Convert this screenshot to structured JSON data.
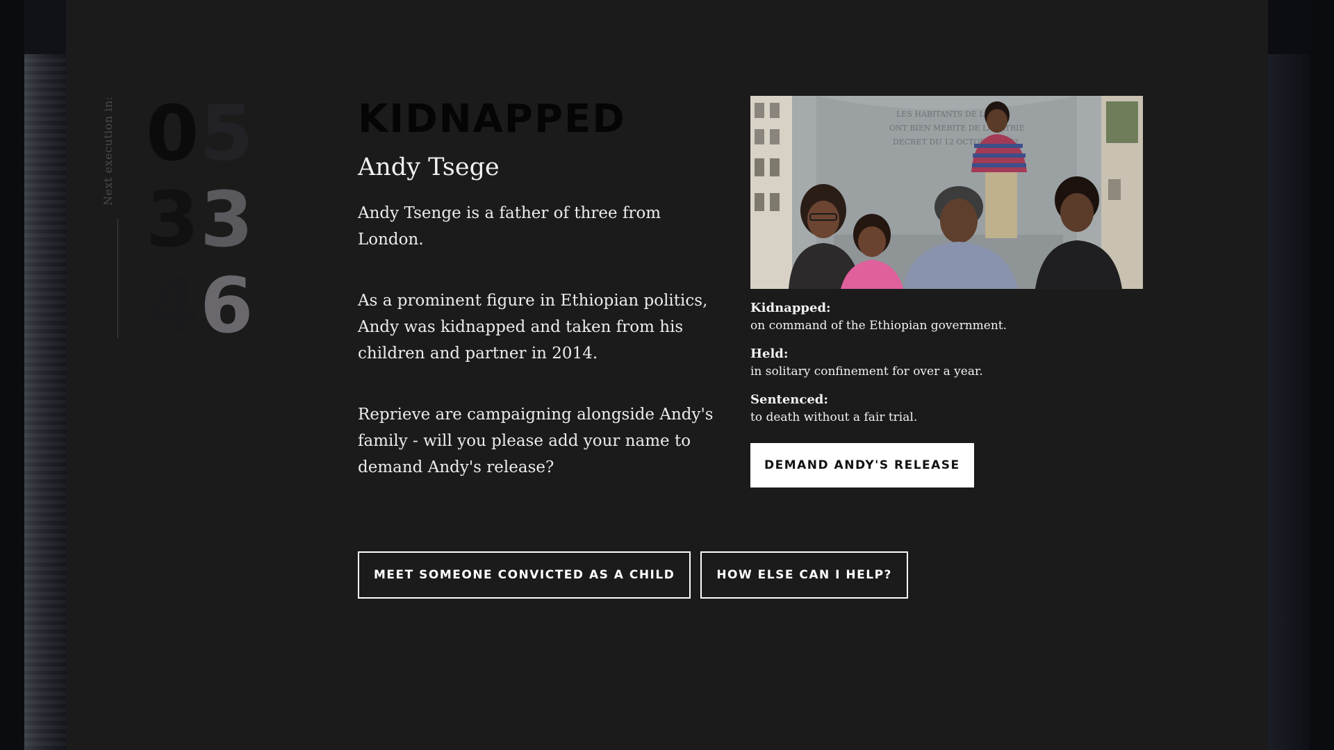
{
  "countdown": {
    "label": "Next execution in:",
    "rows": [
      [
        "0",
        "5"
      ],
      [
        "3",
        "3"
      ],
      [
        "4",
        "6"
      ]
    ]
  },
  "profile": {
    "kicker": "KIDNAPPED",
    "name": "Andy Tsege",
    "paragraphs": [
      "Andy Tsenge is a father of three from London.",
      "As a prominent figure in Ethiopian politics, Andy was kidnapped and taken from his children and partner in 2014.",
      "Reprieve are campaigning alongside Andy's family - will you please add your name to demand Andy's release?"
    ]
  },
  "facts": [
    {
      "label": "Kidnapped:",
      "text": "on command of the Ethiopian government."
    },
    {
      "label": "Held:",
      "text": "in solitary confinement for over a year."
    },
    {
      "label": "Sentenced:",
      "text": "to death without a fair trial."
    }
  ],
  "photo": {
    "inscription": [
      "LES HABITANTS DE LILLE",
      "ONT BIEN MERITE DE LA PATRIE",
      "DECRET DU 12 OCTOBRE 1792"
    ]
  },
  "buttons": {
    "demand": "DEMAND ANDY'S RELEASE",
    "meet": "MEET SOMEONE CONVICTED AS A CHILD",
    "help": "HOW ELSE CAN I HELP?"
  },
  "colors": {
    "panel": "#1b1b1b",
    "text": "#f2f2f2",
    "button_bg": "#ffffff"
  }
}
